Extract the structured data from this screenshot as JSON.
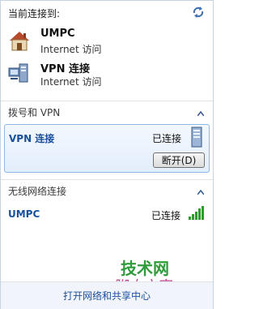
{
  "header": {
    "title": "当前连接到:",
    "refresh_icon": "refresh-icon"
  },
  "current_connections": [
    {
      "name": "UMPC",
      "status": "Internet 访问",
      "icon": "home-network-icon"
    },
    {
      "name": "VPN 连接",
      "status": "Internet 访问",
      "icon": "vpn-network-icon"
    }
  ],
  "sections": {
    "dialup_vpn": {
      "label": "拨号和 VPN",
      "items": [
        {
          "name": "VPN 连接",
          "state": "已连接",
          "action": "断开(D)",
          "icon": "vpn-device-icon"
        }
      ]
    },
    "wireless": {
      "label": "无线网络连接",
      "items": [
        {
          "name": "UMPC",
          "state": "已连接",
          "icon": "signal-bars-icon"
        }
      ]
    }
  },
  "watermark": {
    "line1": "技术网",
    "line2": "脚本之家"
  },
  "footer": {
    "link": "打开网络和共享中心"
  }
}
